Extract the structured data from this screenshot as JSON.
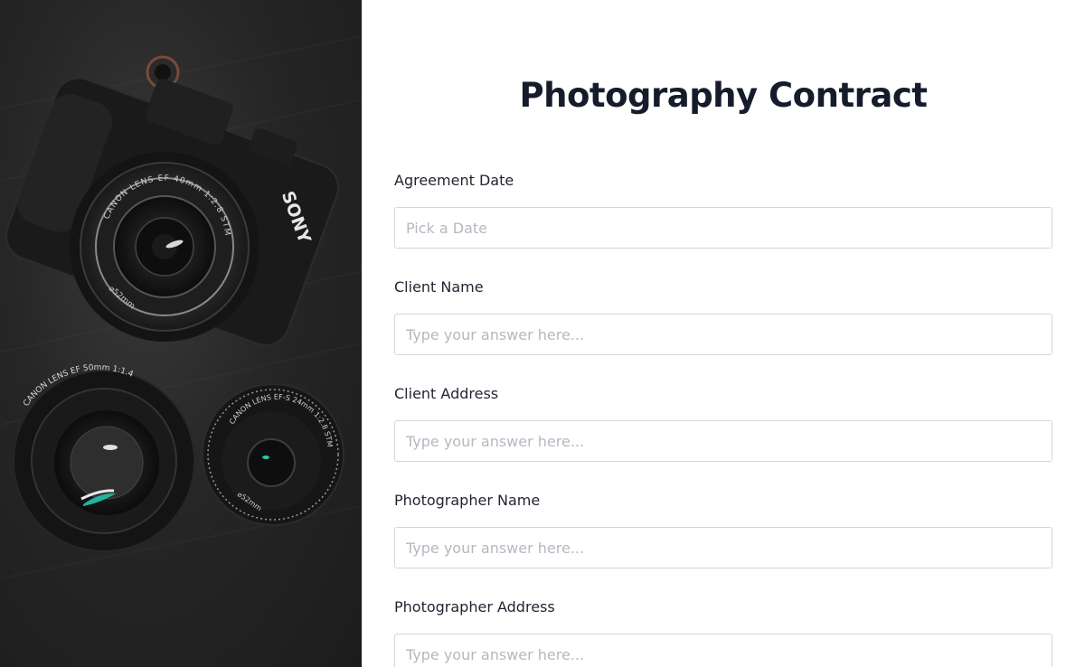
{
  "form": {
    "title": "Photography Contract",
    "fields": [
      {
        "label": "Agreement Date",
        "placeholder": "Pick a Date",
        "value": ""
      },
      {
        "label": "Client Name",
        "placeholder": "Type your answer here...",
        "value": ""
      },
      {
        "label": "Client Address",
        "placeholder": "Type your answer here...",
        "value": ""
      },
      {
        "label": "Photographer Name",
        "placeholder": "Type your answer here...",
        "value": ""
      },
      {
        "label": "Photographer Address",
        "placeholder": "Type your answer here...",
        "value": ""
      }
    ]
  },
  "hero": {
    "camera_brand": "SONY",
    "main_lens_text": "CANON LENS EF 40mm 1:2.8 STM",
    "main_lens_filter": "⌀52mm",
    "lens2_text": "CANON LENS EF 50mm 1:1.4",
    "lens3_text": "CANON LENS EF-S 24mm 1:2.8 STM",
    "lens3_filter": "⌀52mm"
  },
  "colors": {
    "background": "#ffffff",
    "title": "#151c2b",
    "input_border": "#d3d6db",
    "placeholder": "#b4b8c0",
    "hero_dark": "#262626"
  }
}
